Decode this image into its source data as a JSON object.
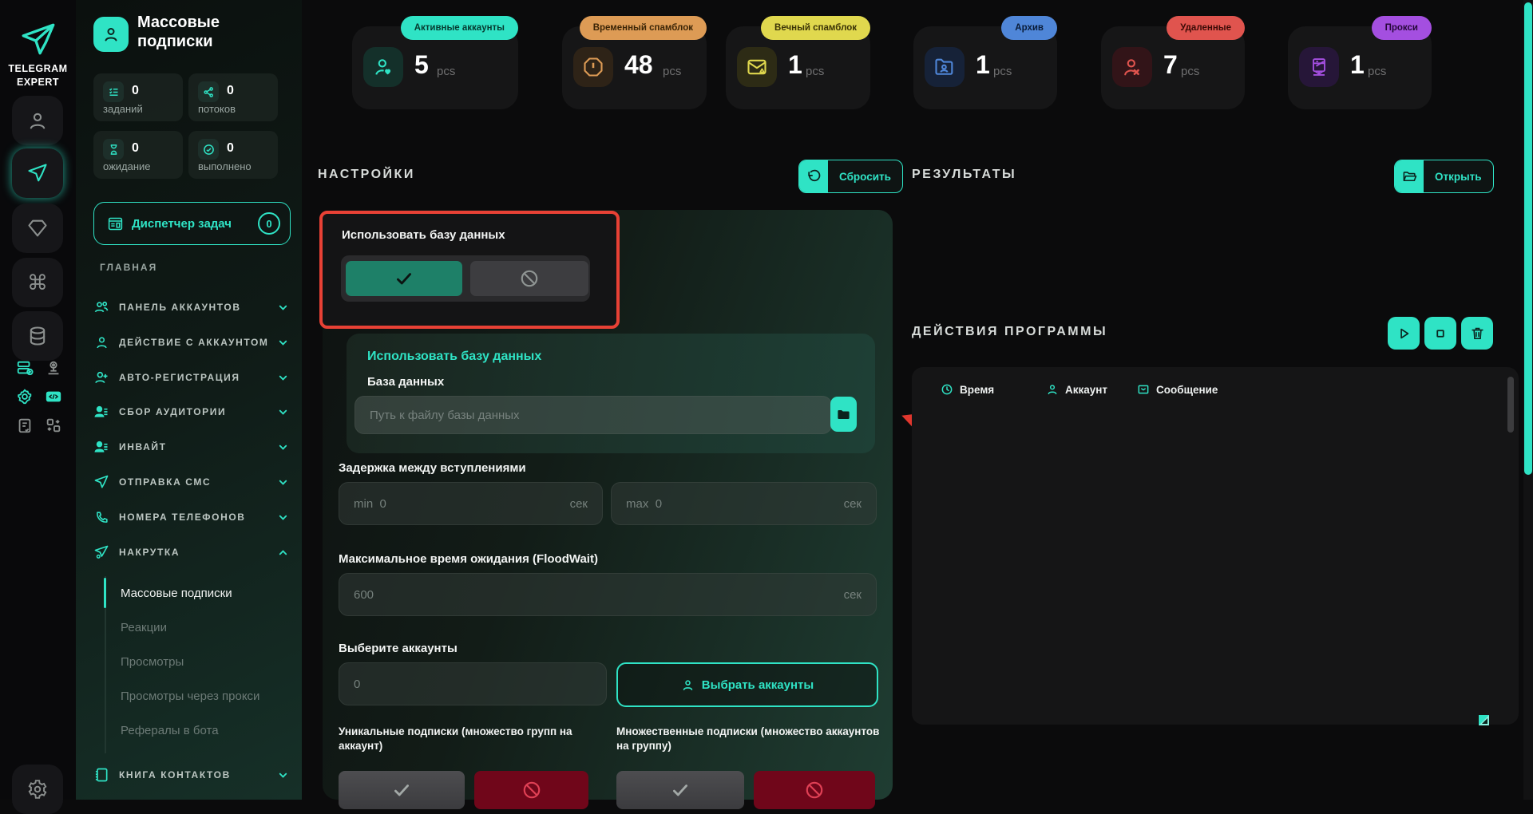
{
  "accent_color": "#2fe3c5",
  "highlight_color": "#e84135",
  "rail": {
    "logo_line1": "TELEGRAM",
    "logo_line2": "EXPERT"
  },
  "sidebar": {
    "title": "Массовые подписки",
    "stats": [
      {
        "value": "0",
        "label": "заданий"
      },
      {
        "value": "0",
        "label": "потоков"
      },
      {
        "value": "0",
        "label": "ожидание"
      },
      {
        "value": "0",
        "label": "выполнено"
      }
    ],
    "task_manager": {
      "label": "Диспетчер задач",
      "badge": "0"
    },
    "section_label": "ГЛАВНАЯ",
    "nav": [
      {
        "label": "ПАНЕЛЬ АККАУНТОВ"
      },
      {
        "label": "ДЕЙСТВИЕ С АККАУНТОМ"
      },
      {
        "label": "АВТО-РЕГИСТРАЦИЯ"
      },
      {
        "label": "СБОР АУДИТОРИИ"
      },
      {
        "label": "ИНВАЙТ"
      },
      {
        "label": "ОТПРАВКА СМС"
      },
      {
        "label": "НОМЕРА ТЕЛЕФОНОВ"
      },
      {
        "label": "НАКРУТКА"
      }
    ],
    "sub_items": [
      {
        "label": "Массовые подписки"
      },
      {
        "label": "Реакции"
      },
      {
        "label": "Просмотры"
      },
      {
        "label": "Просмотры через прокси"
      },
      {
        "label": "Рефералы в бота"
      }
    ],
    "contacts_label": "КНИГА КОНТАКТОВ"
  },
  "top_cards": [
    {
      "badge": "Активные аккаунты",
      "value": "5",
      "unit": "pcs",
      "color": "#2fe3c5"
    },
    {
      "badge": "Временный спамблок",
      "value": "48",
      "unit": "pcs",
      "color": "#dd9b55"
    },
    {
      "badge": "Вечный спамблок",
      "value": "1",
      "unit": "pcs",
      "color": "#e0d84e"
    },
    {
      "badge": "Архив",
      "value": "1",
      "unit": "pcs",
      "color": "#4f86d8"
    },
    {
      "badge": "Удаленные",
      "value": "7",
      "unit": "pcs",
      "color": "#e0544e"
    },
    {
      "badge": "Прокси",
      "value": "1",
      "unit": "pcs",
      "color": "#a44fe0"
    }
  ],
  "settings": {
    "heading": "НАСТРОЙКИ",
    "reset_button": "Сбросить",
    "use_db_label": "Использовать базу данных",
    "db_card": {
      "title": "Использовать базу данных",
      "db_label": "База данных",
      "db_placeholder": "Путь к файлу базы данных"
    },
    "delay": {
      "label": "Задержка между вступлениями",
      "min_prefix": "min",
      "min_value": "0",
      "max_prefix": "max",
      "max_value": "0",
      "unit": "сек"
    },
    "floodwait": {
      "label": "Максимальное время ожидания (FloodWait)",
      "value": "600",
      "unit": "сек"
    },
    "accounts": {
      "label": "Выберите аккаунты",
      "value": "0",
      "select_button": "Выбрать аккаунты"
    },
    "unique_label": "Уникальные подписки (множество групп на аккаунт)",
    "multiple_label": "Множественные подписки (множество аккаунтов на группу)"
  },
  "results": {
    "heading": "РЕЗУЛЬТАТЫ",
    "open_button": "Открыть",
    "actions_heading": "ДЕЙСТВИЯ ПРОГРАММЫ",
    "table_headers": [
      {
        "label": "Время"
      },
      {
        "label": "Аккаунт"
      },
      {
        "label": "Сообщение"
      }
    ]
  }
}
